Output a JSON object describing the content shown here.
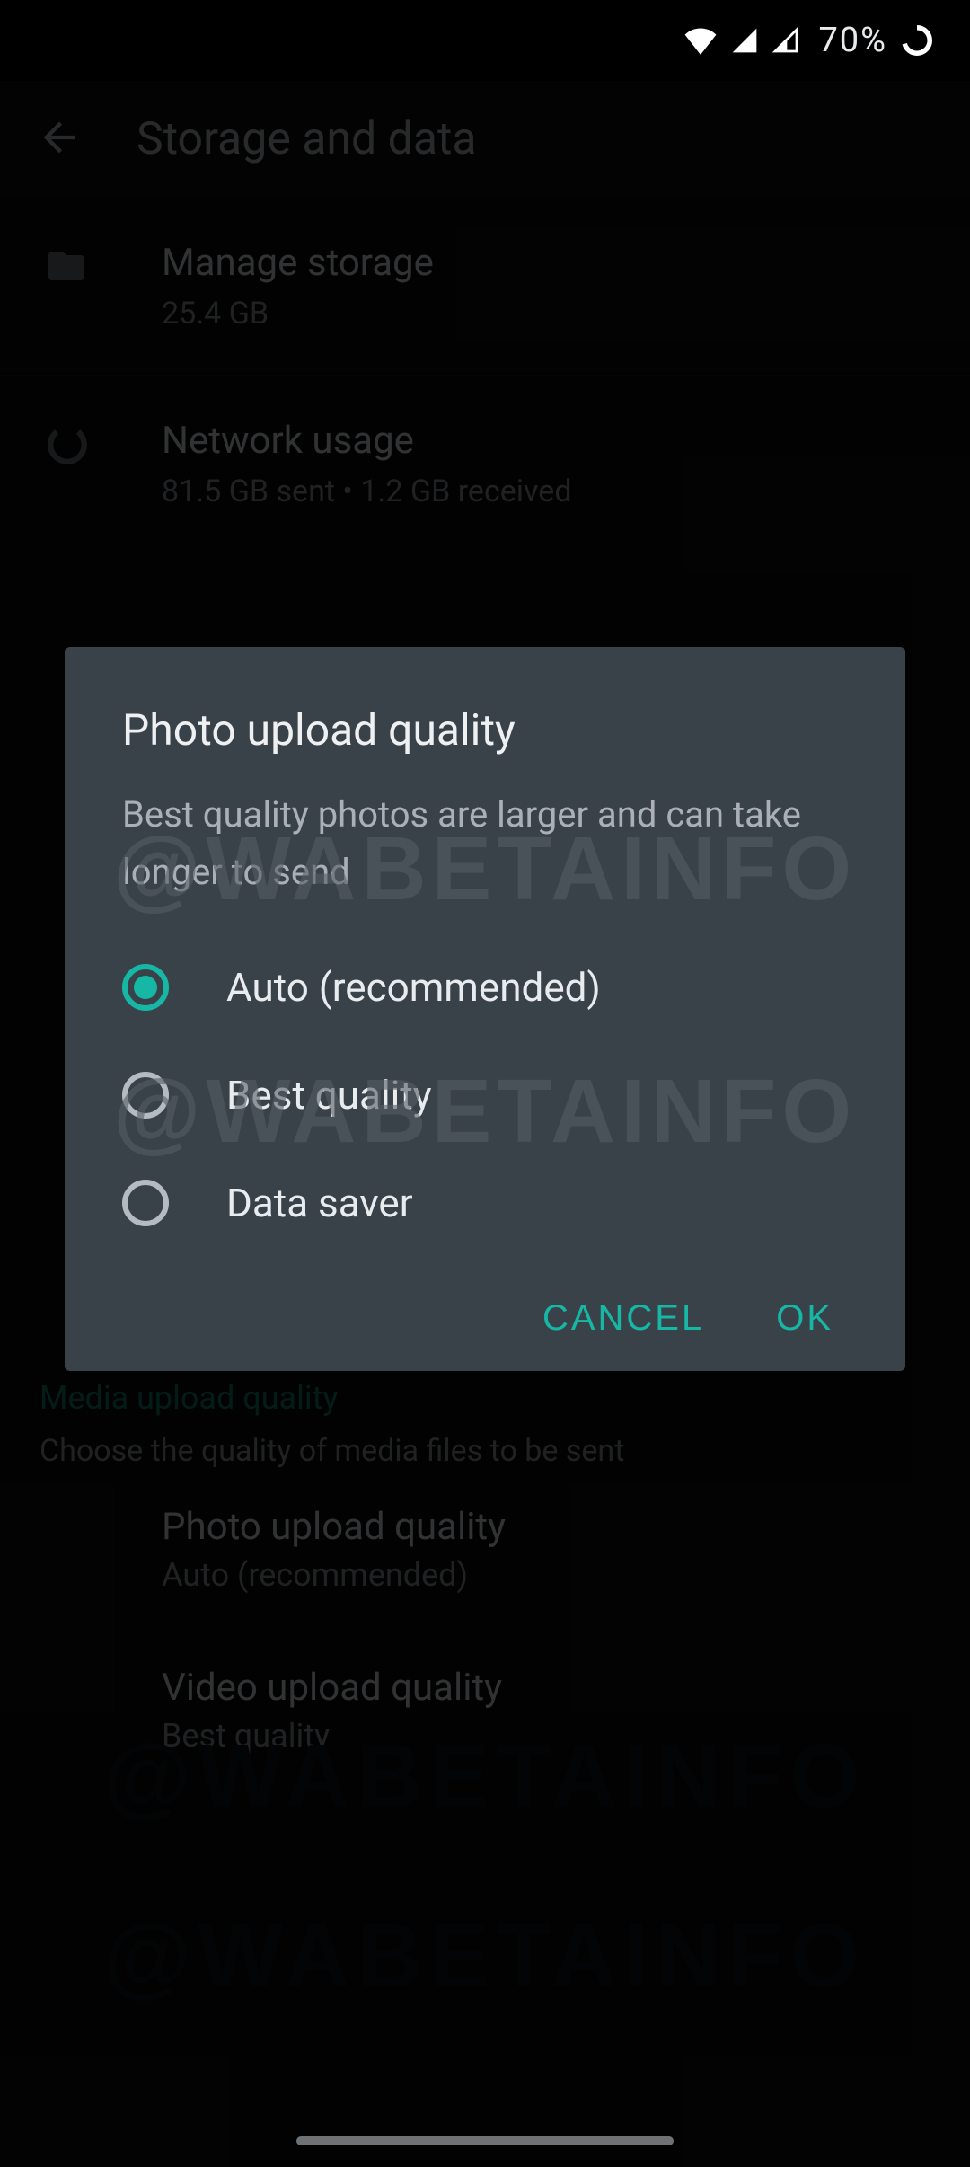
{
  "status": {
    "battery_text": "70%"
  },
  "appbar": {
    "title": "Storage and data"
  },
  "items": {
    "manage_storage": {
      "title": "Manage storage",
      "sub": "25.4 GB"
    },
    "network_usage": {
      "title": "Network usage",
      "sub": "81.5 GB sent • 1.2 GB received"
    }
  },
  "media_section": {
    "header": "Media upload quality",
    "sub": "Choose the quality of media files to be sent",
    "photo": {
      "title": "Photo upload quality",
      "sub": "Auto (recommended)"
    },
    "video": {
      "title": "Video upload quality",
      "sub": "Best quality"
    }
  },
  "dialog": {
    "title": "Photo upload quality",
    "desc": "Best quality photos are larger and can take longer to send",
    "options": {
      "auto": "Auto (recommended)",
      "best": "Best quality",
      "saver": "Data saver"
    },
    "selected": "auto",
    "cancel": "CANCEL",
    "ok": "OK"
  },
  "watermark": "@WABETAINFO",
  "colors": {
    "accent": "#17b7a6",
    "dialog_bg": "#3a4249",
    "bg": "#000000"
  }
}
